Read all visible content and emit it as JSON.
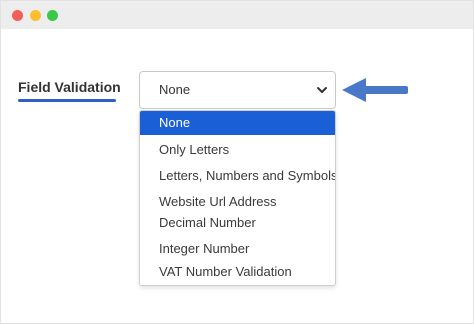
{
  "window": {
    "controls": [
      {
        "name": "close",
        "color": "#f25f58"
      },
      {
        "name": "minimize",
        "color": "#fbbe2e"
      },
      {
        "name": "maximize",
        "color": "#3bc748"
      }
    ]
  },
  "form": {
    "field_label": "Field Validation",
    "underline_color": "#2f5fc8",
    "select_value": "None",
    "arrow_color": "#4a78c9"
  },
  "dropdown": {
    "selected_color": "#1a5fd6",
    "options": [
      {
        "label": "None",
        "selected": true
      },
      {
        "label": "Only Letters",
        "selected": false
      },
      {
        "label": "Letters, Numbers and Symbols",
        "selected": false
      },
      {
        "label": "Website Url Address",
        "selected": false
      },
      {
        "label": "Decimal Number",
        "selected": false
      },
      {
        "label": "Integer Number",
        "selected": false
      },
      {
        "label": "VAT Number Validation",
        "selected": false
      }
    ]
  }
}
